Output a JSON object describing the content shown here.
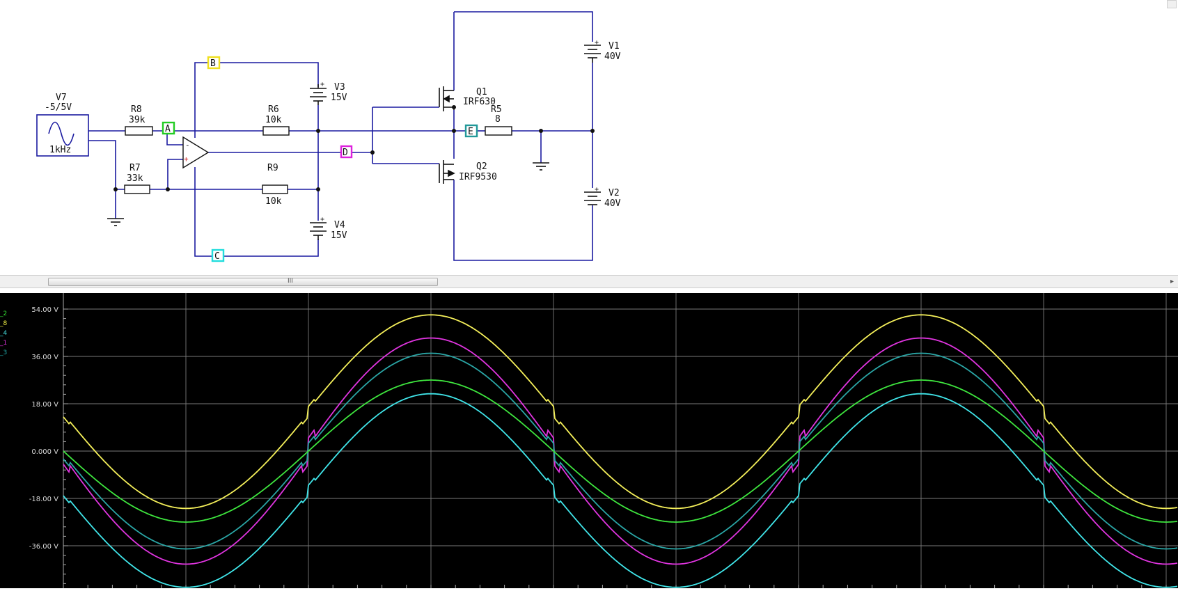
{
  "schematic": {
    "components": {
      "v7": {
        "name": "V7",
        "value": "-5/5V",
        "freq": "1kHz"
      },
      "r8": {
        "name": "R8",
        "value": "39k"
      },
      "r7": {
        "name": "R7",
        "value": "33k"
      },
      "r6": {
        "name": "R6",
        "value": "10k"
      },
      "r9": {
        "name": "R9",
        "value": "10k"
      },
      "v3": {
        "name": "V3",
        "value": "15V"
      },
      "v4": {
        "name": "V4",
        "value": "15V"
      },
      "q1": {
        "name": "Q1",
        "part": "IRF630"
      },
      "q2": {
        "name": "Q2",
        "part": "IRF9530"
      },
      "r5": {
        "name": "R5",
        "value": "8"
      },
      "v1": {
        "name": "V1",
        "value": "40V"
      },
      "v2": {
        "name": "V2",
        "value": "40V"
      }
    },
    "plus_sign": "+",
    "opamp_inv": "-",
    "opamp_noninv": "+",
    "probes": {
      "a": {
        "label": "A",
        "color": "#22cc22"
      },
      "b": {
        "label": "B",
        "color": "#f0e020"
      },
      "c": {
        "label": "C",
        "color": "#22dddd"
      },
      "d": {
        "label": "D",
        "color": "#dd22dd"
      },
      "e": {
        "label": "E",
        "color": "#229999"
      }
    },
    "scroll_grip": "III"
  },
  "scope": {
    "y_ticks": [
      "54.00 V",
      "36.00 V",
      "18.00 V",
      "0.000 V",
      "-18.00 V",
      "-36.00 V"
    ],
    "legend": [
      {
        "label": "_2",
        "color": "#33dd33"
      },
      {
        "label": "_8",
        "color": "#eeee44"
      },
      {
        "label": "_4",
        "color": "#44dddd"
      },
      {
        "label": "_1",
        "color": "#dd33dd"
      },
      {
        "label": "_3",
        "color": "#22aaaa"
      }
    ]
  },
  "chart_data": {
    "type": "line",
    "y_unit": "V",
    "ylim": [
      -50,
      54
    ],
    "grid": true,
    "series": [
      {
        "color": "#f5f05a",
        "amplitude": 36,
        "offset": 15,
        "glitch": 2
      },
      {
        "color": "#e034e0",
        "amplitude": 41,
        "offset": 0,
        "glitch": 5
      },
      {
        "color": "#2aa6a6",
        "amplitude": 36,
        "offset": 0,
        "glitch": 3
      },
      {
        "color": "#3ee63e",
        "amplitude": 27,
        "offset": 0,
        "glitch": 0
      },
      {
        "color": "#40e6ea",
        "amplitude": 36,
        "offset": -15,
        "glitch": 2
      }
    ]
  }
}
